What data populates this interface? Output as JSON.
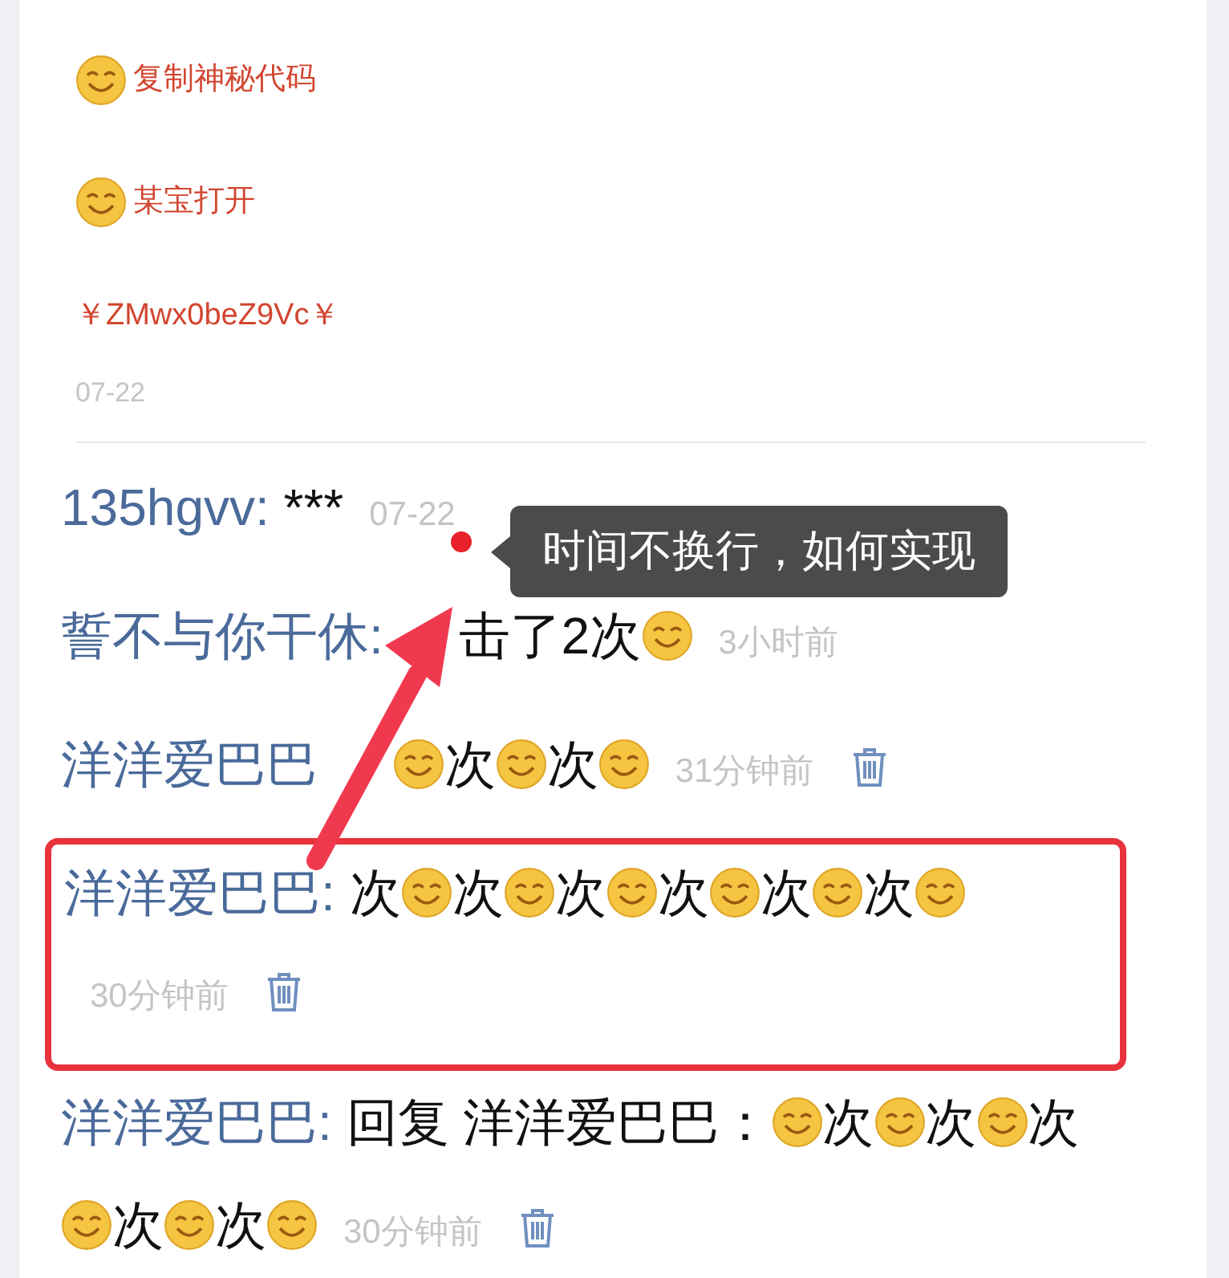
{
  "post": {
    "lines": [
      {
        "kind": "emoji_text",
        "text": "复制神秘代码"
      },
      {
        "kind": "emoji_text",
        "text": "某宝打开"
      },
      {
        "kind": "text",
        "text": "￥ZMwx0beZ9Vc￥"
      }
    ],
    "date": "07-22"
  },
  "comments": [
    {
      "user": "135hgvv:",
      "parts": [
        {
          "kind": "text",
          "text": "***"
        }
      ],
      "time": "07-22",
      "deletable": false,
      "highlighted": false
    },
    {
      "user": "誓不与你干休:",
      "parts": [
        {
          "kind": "gap"
        },
        {
          "kind": "text",
          "text": "击了2次"
        },
        {
          "kind": "emoji"
        }
      ],
      "time": "3小时前",
      "deletable": false,
      "highlighted": false
    },
    {
      "user": "洋洋爱巴巴",
      "parts": [
        {
          "kind": "gap"
        },
        {
          "kind": "emoji"
        },
        {
          "kind": "text",
          "text": "次"
        },
        {
          "kind": "emoji"
        },
        {
          "kind": "text",
          "text": "次"
        },
        {
          "kind": "emoji"
        }
      ],
      "time": "31分钟前",
      "deletable": true,
      "highlighted": false
    },
    {
      "user": "洋洋爱巴巴:",
      "parts": [
        {
          "kind": "text",
          "text": "次"
        },
        {
          "kind": "emoji"
        },
        {
          "kind": "text",
          "text": "次"
        },
        {
          "kind": "emoji"
        },
        {
          "kind": "text",
          "text": "次"
        },
        {
          "kind": "emoji"
        },
        {
          "kind": "text",
          "text": "次"
        },
        {
          "kind": "emoji"
        },
        {
          "kind": "text",
          "text": "次"
        },
        {
          "kind": "emoji"
        },
        {
          "kind": "text",
          "text": "次"
        },
        {
          "kind": "emoji"
        }
      ],
      "time": "30分钟前",
      "deletable": true,
      "highlighted": true
    },
    {
      "user": "洋洋爱巴巴:",
      "parts": [
        {
          "kind": "text",
          "text": "回复 洋洋爱巴巴："
        },
        {
          "kind": "emoji"
        },
        {
          "kind": "text",
          "text": "次"
        },
        {
          "kind": "emoji"
        },
        {
          "kind": "text",
          "text": "次"
        },
        {
          "kind": "emoji"
        },
        {
          "kind": "text",
          "text": "次"
        },
        {
          "kind": "emoji"
        },
        {
          "kind": "text",
          "text": "次"
        },
        {
          "kind": "emoji"
        },
        {
          "kind": "text",
          "text": "次"
        },
        {
          "kind": "emoji"
        }
      ],
      "time": "30分钟前",
      "deletable": true,
      "highlighted": false
    }
  ],
  "annotation": {
    "tooltip": "时间不换行，如何实现"
  }
}
